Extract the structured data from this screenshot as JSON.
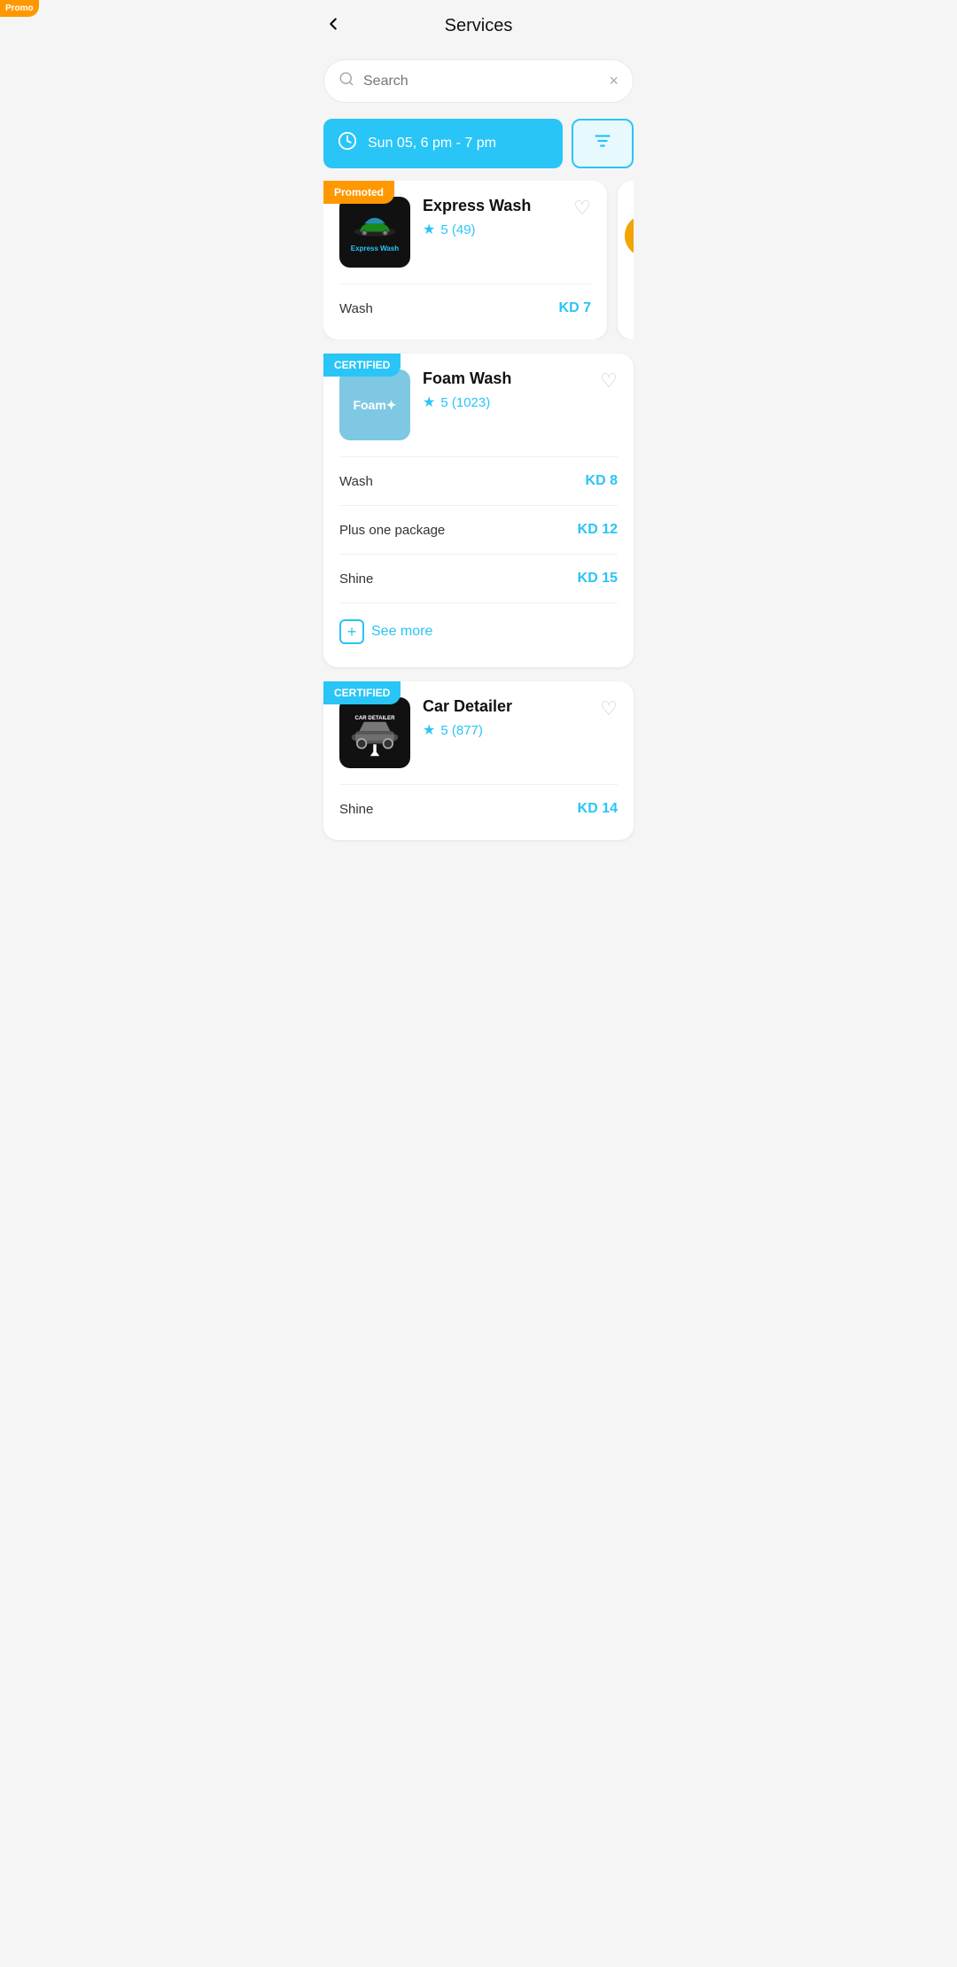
{
  "header": {
    "title": "Services",
    "back_label": "←"
  },
  "search": {
    "placeholder": "Search",
    "clear_label": "×"
  },
  "date_filter": {
    "label": "Sun 05, 6 pm - 7 pm"
  },
  "badges": {
    "promoted": "Promoted",
    "certified": "CERTIFIED"
  },
  "cards": [
    {
      "id": "express-wash",
      "badge": "Promoted",
      "badge_type": "promoted",
      "name": "Express Wash",
      "rating": "5 (49)",
      "logo_type": "express",
      "logo_text": "Express Wash",
      "services": [
        {
          "label": "Wash",
          "price": "KD 7"
        }
      ]
    },
    {
      "id": "foam-wash",
      "badge": "CERTIFIED",
      "badge_type": "certified",
      "name": "Foam Wash",
      "rating": "5 (1023)",
      "logo_type": "foam",
      "logo_text": "Foam",
      "services": [
        {
          "label": "Wash",
          "price": "KD 8"
        },
        {
          "label": "Plus one package",
          "price": "KD 12"
        },
        {
          "label": "Shine",
          "price": "KD 15"
        }
      ],
      "see_more": "See more"
    },
    {
      "id": "car-detailer",
      "badge": "CERTIFIED",
      "badge_type": "certified",
      "name": "Car Detailer",
      "rating": "5 (877)",
      "logo_type": "cardetailer",
      "logo_text": "CAR DETAILER",
      "services": [
        {
          "label": "Shine",
          "price": "KD 14"
        }
      ]
    }
  ],
  "colors": {
    "accent": "#29c5f6",
    "promoted": "#ff9800",
    "certified": "#29c5f6"
  }
}
